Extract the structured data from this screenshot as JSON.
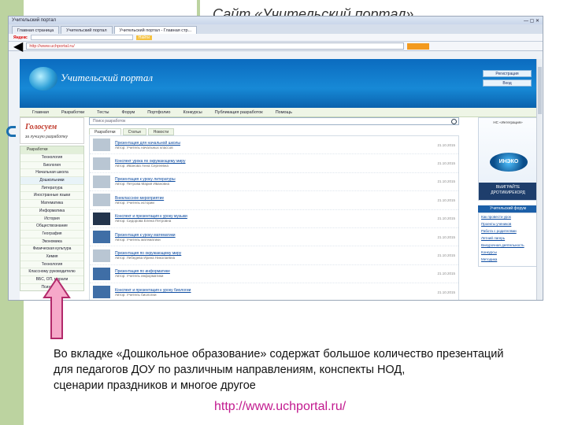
{
  "slide": {
    "title": "Сайт «Учительский портал»",
    "caption_lines": [
      "Во вкладке «Дошкольное образование» содержат большое количество презентаций",
      "для педагогов ДОУ по различным направлениям, конспекты НОД,",
      "сценарии праздников и многое другое"
    ],
    "url": "http://www.uchportal.ru/"
  },
  "browser": {
    "window_title": "Учительский портал",
    "tabs": [
      "Главная страница",
      "Учительский портал",
      "Учительский портал - Главная стр..."
    ],
    "toolbar": {
      "logo": "Яндекс",
      "find_label": "Найти"
    },
    "address": "http://www.uchportal.ru/"
  },
  "site": {
    "logo_text": "Учительский портал",
    "header_buttons": [
      "Регистрация",
      "Вход"
    ],
    "nav": [
      "Главная",
      "Разработки",
      "Тесты",
      "Форум",
      "Портфолио",
      "Конкурсы",
      "Публикация разработок",
      "Помощь"
    ],
    "banner": {
      "title": "Голосуем",
      "subtitle": "за лучшую разработку"
    },
    "sidebar": {
      "header": "Разработки",
      "items": [
        "Технология",
        "Биология",
        "Начальная школа",
        "Дошкольники",
        "Литература",
        "Иностранные языки",
        "Математика",
        "Информатика",
        "История",
        "Обществознание",
        "География",
        "Экономика",
        "Физическая культура",
        "Химия",
        "Технология",
        "Классному руководителю",
        "ВБС, ОП, морали",
        "Психология"
      ]
    },
    "search_placeholder": "Поиск разработок",
    "content_tabs": [
      "Разработки",
      "Статьи",
      "Новости"
    ],
    "items": [
      {
        "title": "Презентация для начальной школы",
        "meta": "Автор: Учитель начальных классов",
        "date": "21.10.2015",
        "thumb": "light"
      },
      {
        "title": "Конспект урока по окружающему миру",
        "meta": "Автор: Иванова Анна Сергеевна",
        "date": "21.10.2015",
        "thumb": "light"
      },
      {
        "title": "Презентация к уроку литературы",
        "meta": "Автор: Петрова Мария Ивановна",
        "date": "21.10.2015",
        "thumb": "light"
      },
      {
        "title": "Внеклассное мероприятие",
        "meta": "Автор: Учитель истории",
        "date": "21.10.2015",
        "thumb": "light"
      },
      {
        "title": "Конспект и презентация к уроку музыки",
        "meta": "Автор: Сидорова Елена Петровна",
        "date": "21.10.2015",
        "thumb": "dark"
      },
      {
        "title": "Презентация к уроку математики",
        "meta": "Автор: Учитель математики",
        "date": "21.10.2015",
        "thumb": "blue"
      },
      {
        "title": "Презентация по окружающему миру",
        "meta": "Автор: Лебедева Ирина Николаевна",
        "date": "21.10.2015",
        "thumb": "light"
      },
      {
        "title": "Презентация по информатике",
        "meta": "Автор: Учитель информатики",
        "date": "21.10.2015",
        "thumb": "blue"
      },
      {
        "title": "Конспект и презентация к уроку биологии",
        "meta": "Автор: Учитель биологии",
        "date": "21.10.2015",
        "thumb": "blue"
      }
    ],
    "ad": {
      "text": "НС «Интеграция»",
      "orb": "ИНЭКО",
      "bottom": "ВЫИГРАЙТЕ ДРОТИКИРЕКОРД"
    },
    "right_header": "Учительский форум",
    "right_links": [
      "Как провести урок",
      "Проекты учеников",
      "Работа с родителями",
      "Летний лагерь",
      "Внеурочная деятельность",
      "Конкурсы",
      "Методика"
    ]
  }
}
